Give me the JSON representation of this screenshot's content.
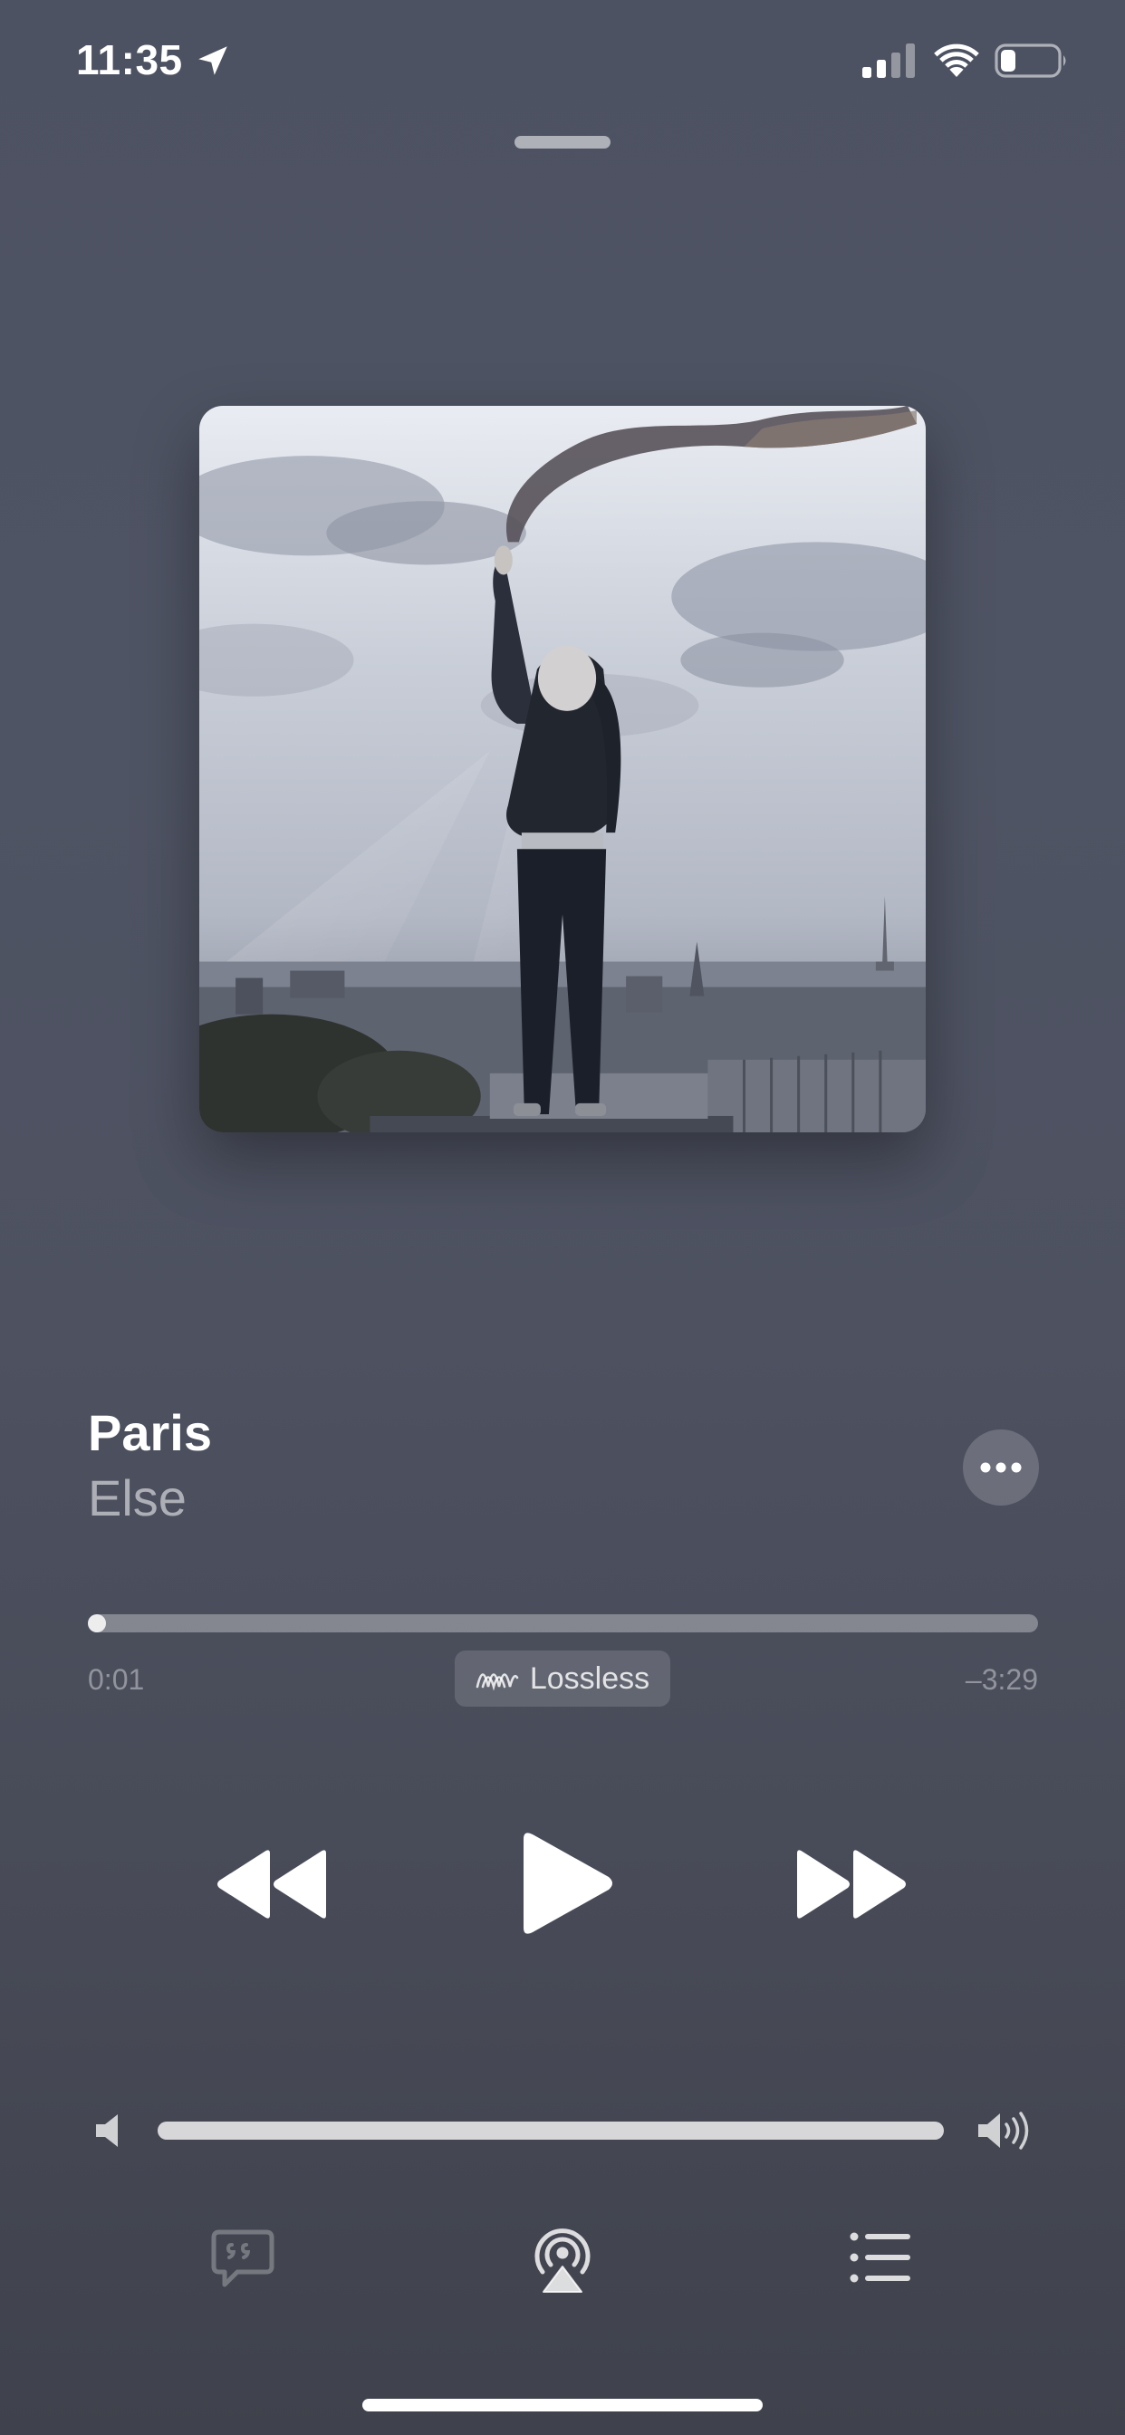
{
  "status_bar": {
    "time": "11:35",
    "icons": [
      "location-arrow-icon",
      "cellular-signal-icon",
      "wifi-icon",
      "battery-icon"
    ]
  },
  "now_playing": {
    "title": "Paris",
    "artist": "Else",
    "artwork": "person holding smoke flare over Paris skyline",
    "elapsed": "0:01",
    "remaining": "–3:29",
    "progress_fraction": 0.005,
    "badge_label": "Lossless"
  },
  "controls": {
    "icons": [
      "rewind-icon",
      "play-icon",
      "fast-forward-icon"
    ]
  },
  "volume": {
    "level_fraction": 1.0,
    "icons": [
      "speaker-low-icon",
      "speaker-high-icon"
    ]
  },
  "toolbar": {
    "icons": [
      "lyrics-icon",
      "airplay-icon",
      "queue-icon"
    ]
  },
  "colors": {
    "background": "#4d5262",
    "accent": "#ffffff"
  }
}
